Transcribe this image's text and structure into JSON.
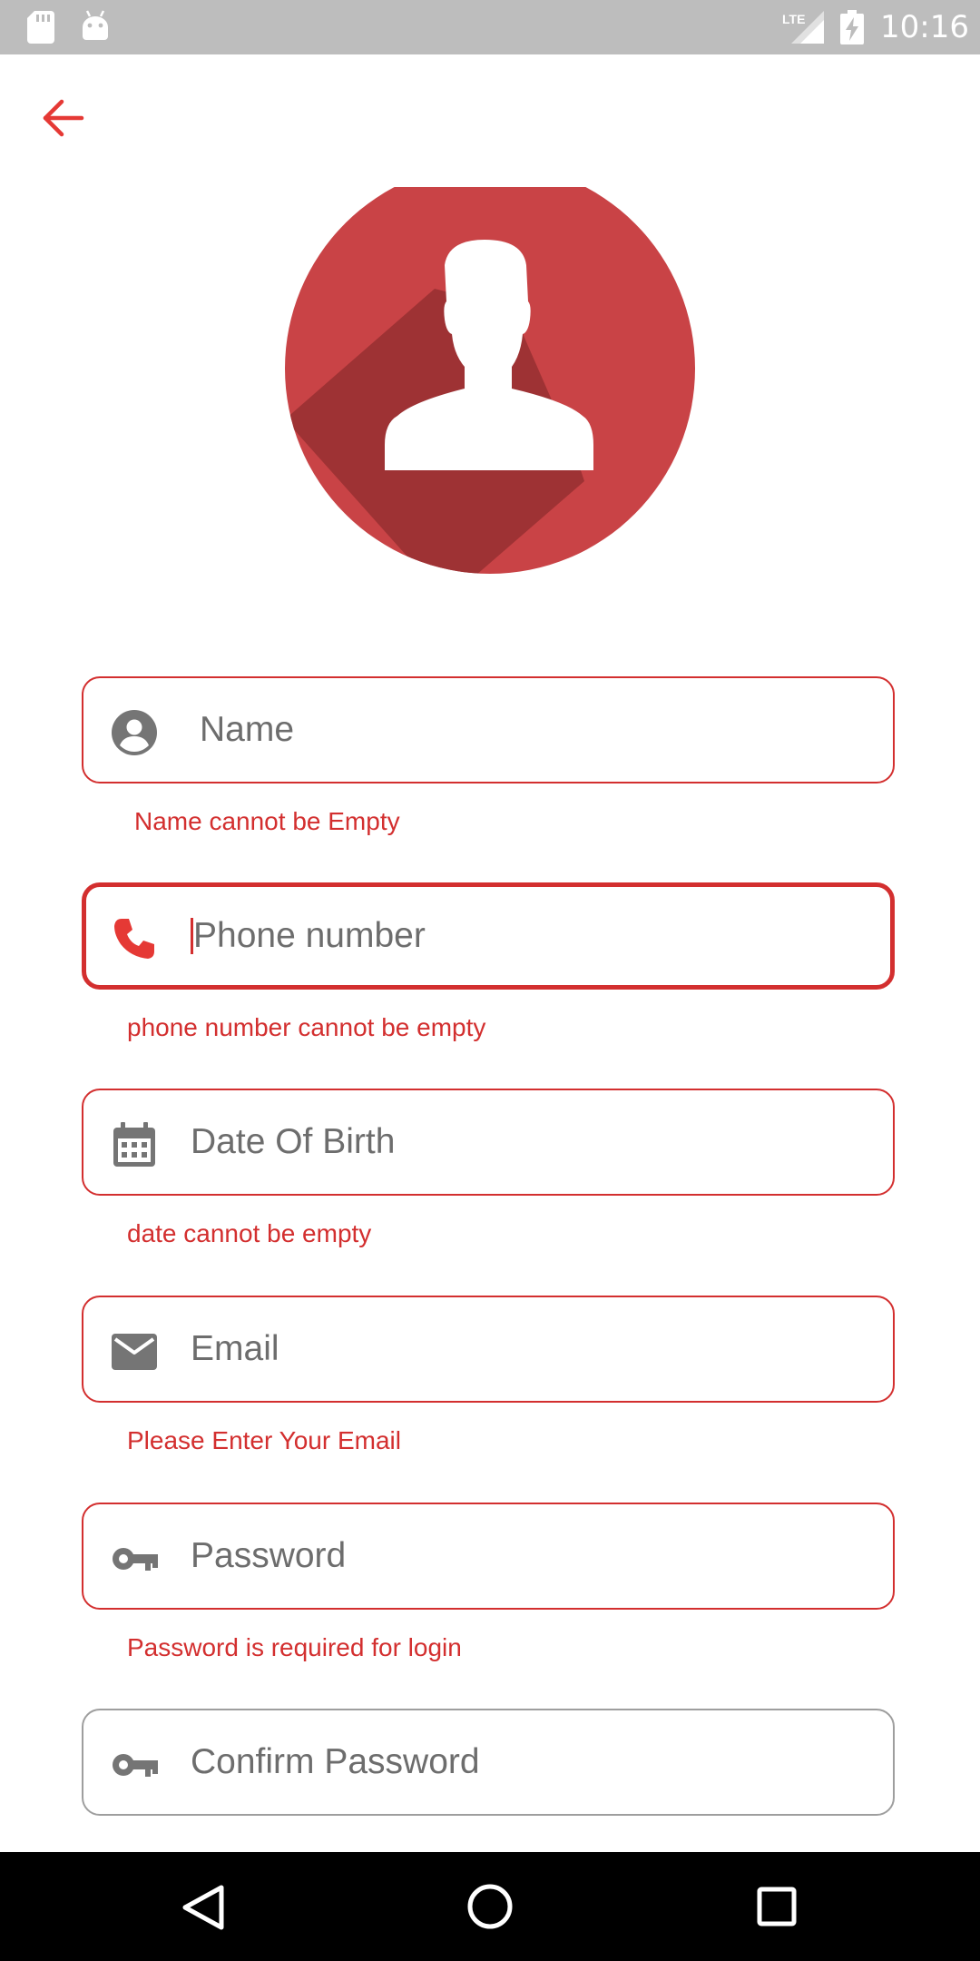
{
  "status_bar": {
    "time": "10:16",
    "network_label": "LTE",
    "icons": [
      "sd-card-icon",
      "android-icon",
      "lte-signal-icon",
      "battery-charging-icon"
    ]
  },
  "header": {
    "back_icon": "arrow-left-icon"
  },
  "avatar": {
    "icon": "user-avatar-icon",
    "color": "#c94346"
  },
  "form": {
    "fields": [
      {
        "id": "name",
        "placeholder": "Name",
        "icon": "account-circle-icon",
        "error": "Name cannot be Empty",
        "focused": false
      },
      {
        "id": "phone",
        "placeholder": "Phone number",
        "icon": "phone-icon",
        "error": "phone number cannot be empty",
        "focused": true
      },
      {
        "id": "dob",
        "placeholder": "Date Of Birth",
        "icon": "calendar-icon",
        "error": "date cannot be empty",
        "focused": false
      },
      {
        "id": "email",
        "placeholder": "Email",
        "icon": "mail-icon",
        "error": "Please Enter Your Email",
        "focused": false
      },
      {
        "id": "password",
        "placeholder": "Password",
        "icon": "key-icon",
        "error": "Password is required for login",
        "focused": false
      },
      {
        "id": "confirm_password",
        "placeholder": "Confirm Password",
        "icon": "key-icon",
        "error": "",
        "focused": false
      }
    ]
  },
  "nav_bar": {
    "icons": [
      "nav-back-icon",
      "nav-home-icon",
      "nav-recents-icon"
    ]
  },
  "colors": {
    "accent": "#d32f2f",
    "status_bar": "#bdbdbd",
    "icon_gray": "#757575"
  }
}
